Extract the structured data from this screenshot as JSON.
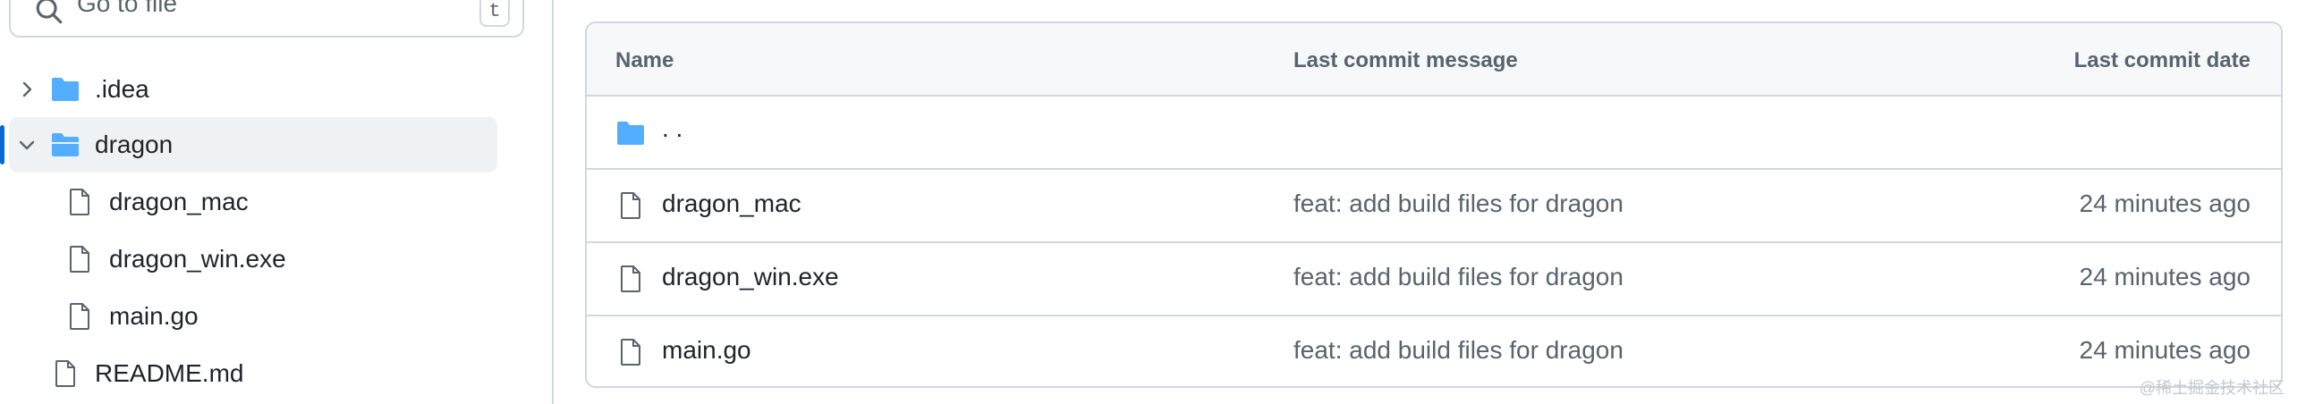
{
  "search": {
    "placeholder": "Go to file",
    "shortcut": "t"
  },
  "tree": {
    "items": [
      {
        "label": ".idea",
        "type": "folder"
      },
      {
        "label": "dragon",
        "type": "folder",
        "expanded": true
      },
      {
        "label": "dragon_mac",
        "type": "file"
      },
      {
        "label": "dragon_win.exe",
        "type": "file"
      },
      {
        "label": "main.go",
        "type": "file"
      },
      {
        "label": "README.md",
        "type": "file"
      }
    ]
  },
  "table": {
    "headers": {
      "name": "Name",
      "message": "Last commit message",
      "date": "Last commit date"
    },
    "parent_label": ". .",
    "rows": [
      {
        "name": "dragon_mac",
        "message": "feat: add build files for dragon",
        "date": "24 minutes ago"
      },
      {
        "name": "dragon_win.exe",
        "message": "feat: add build files for dragon",
        "date": "24 minutes ago"
      },
      {
        "name": "main.go",
        "message": "feat: add build files for dragon",
        "date": "24 minutes ago"
      }
    ]
  },
  "watermark": "@稀土掘金技术社区",
  "colors": {
    "folder": "#54aeff",
    "accent": "#0969da",
    "muted": "#59636e",
    "border": "#d0d7de"
  },
  "icons": [
    "search-icon",
    "chevron-right-icon",
    "chevron-down-icon",
    "folder-icon",
    "folder-open-icon",
    "file-icon"
  ]
}
